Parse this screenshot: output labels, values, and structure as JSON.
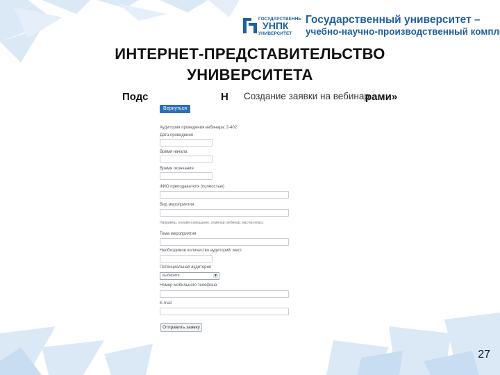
{
  "brand": {
    "logo_text_top": "ГОСУДАРСТВЕННЫЙ",
    "logo_text_mid": "УНПК",
    "logo_text_bottom": "УНИВЕРСИТЕТ",
    "line1": "Государственный университет –",
    "line2": "учебно-научно-производственный комплекс",
    "color": "#1f5f9e"
  },
  "slide": {
    "title_line1": "ИНТЕРНЕТ-ПРЕДСТАВИТЕЛЬСТВО",
    "title_line2": "УНИВЕРСИТЕТА",
    "subtitle_left": "Подс",
    "subtitle_mid": "Н",
    "subtitle_right": "рами»",
    "page_number": "27"
  },
  "form": {
    "heading": "Создание заявки на вебинар",
    "back_button": "Вернуться",
    "auditorium_label": "Аудитория проведения вебинара: 2-402",
    "fields": [
      {
        "label": "Дата проведения"
      },
      {
        "label": "Время начала"
      },
      {
        "label": "Время окончания"
      },
      {
        "label": "ФИО преподавателя (полностью)"
      },
      {
        "label": "Вид мероприятия"
      },
      {
        "label": "Тема мероприятия"
      },
      {
        "label": "Необходимое количество аудиторий: мест"
      },
      {
        "label": "Потенциальная аудитория"
      },
      {
        "label": "Номер мобильного телефона"
      },
      {
        "label": "E-mail"
      }
    ],
    "event_type_hint": "Например, онлайн-совещание, семинар, вебинар, мастер-класс",
    "audience_selected": "выберите",
    "submit_button": "Отправить заявку"
  }
}
